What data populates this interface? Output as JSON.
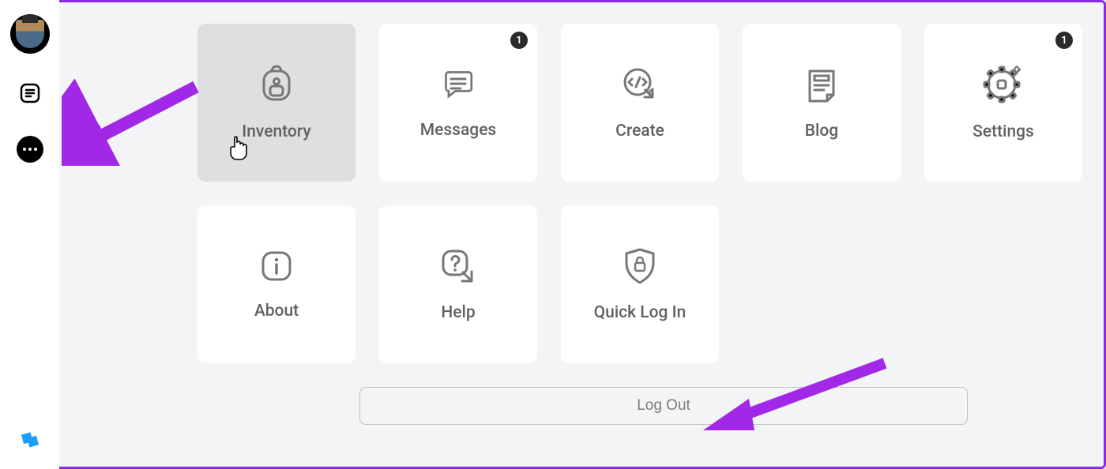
{
  "sidebar": {
    "avatar_alt": "User avatar",
    "feed_icon": "feed-icon",
    "more_icon": "more-icon",
    "logo_icon": "roblox-studio-icon"
  },
  "tiles": {
    "inventory": {
      "label": "Inventory",
      "badge": null
    },
    "messages": {
      "label": "Messages",
      "badge": "1"
    },
    "create": {
      "label": "Create",
      "badge": null
    },
    "blog": {
      "label": "Blog",
      "badge": null
    },
    "settings": {
      "label": "Settings",
      "badge": "1"
    },
    "about": {
      "label": "About",
      "badge": null
    },
    "help": {
      "label": "Help",
      "badge": null
    },
    "quicklogin": {
      "label": "Quick Log In",
      "badge": null
    }
  },
  "logout_label": "Log Out"
}
